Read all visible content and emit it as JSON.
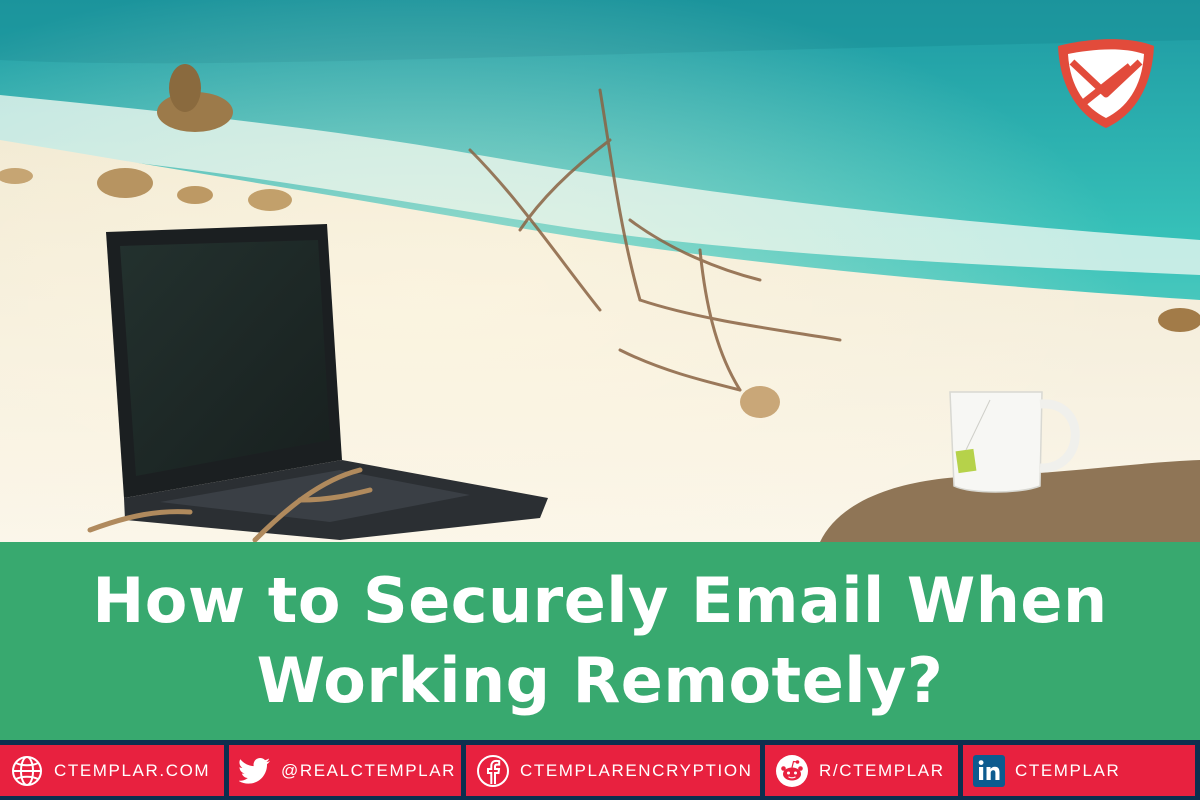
{
  "brand": {
    "logo_icon": "ctemplar-shield-envelope-icon",
    "logo_color": "#e24b3b"
  },
  "title": {
    "line1": "How to Securely Email When",
    "line2": "Working Remotely?"
  },
  "colors": {
    "title_band": "#38a96f",
    "footer_bg": "#0d2f4f",
    "social_bg": "#e8213f"
  },
  "footer": {
    "items": [
      {
        "icon": "globe-icon",
        "label": "CTEMPLAR.COM"
      },
      {
        "icon": "twitter-icon",
        "label": "@REALCTEMPLAR"
      },
      {
        "icon": "facebook-icon",
        "label": "CTEMPLARENCRYPTION"
      },
      {
        "icon": "reddit-icon",
        "label": "R/CTEMPLAR"
      },
      {
        "icon": "linkedin-icon",
        "label": "CTEMPLAR"
      }
    ]
  }
}
